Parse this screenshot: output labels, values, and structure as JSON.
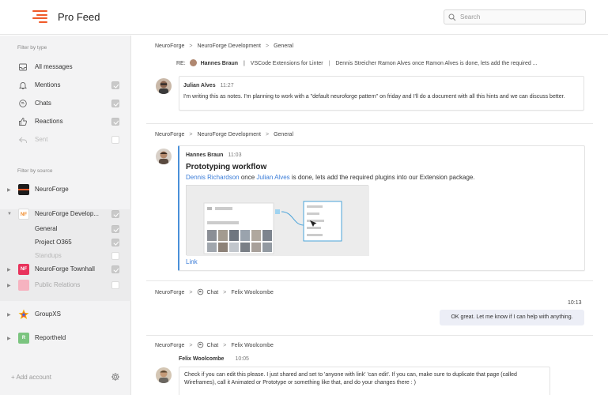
{
  "app": {
    "title": "Pro Feed"
  },
  "search": {
    "placeholder": "Search"
  },
  "sidebar": {
    "filter_by_type": "Filter by type",
    "types": [
      {
        "label": "All messages",
        "icon": "inbox-icon"
      },
      {
        "label": "Mentions",
        "icon": "bell-icon",
        "checked": true
      },
      {
        "label": "Chats",
        "icon": "chat-icon",
        "checked": true
      },
      {
        "label": "Reactions",
        "icon": "thumbs-up-icon",
        "checked": true
      },
      {
        "label": "Sent",
        "icon": "reply-icon",
        "checked": false
      }
    ],
    "filter_by_source": "Filter by source",
    "sources": {
      "neuroforge": "NeuroForge",
      "neuroforge_dev": "NeuroForge Develop...",
      "general": "General",
      "project_o365": "Project O365",
      "standups": "Standups",
      "townhall": "NeuroForge Townhall",
      "public_relations": "Public Relations",
      "groupxs": "GroupXS",
      "reportheld": "Reportheld"
    },
    "badges": {
      "dev": "NF",
      "townhall": "NF",
      "reportheld": "R"
    },
    "add_account": "+ Add account"
  },
  "feed": {
    "crumb_sep": ">",
    "item1": {
      "crumbs": [
        "NeuroForge",
        "NeuroForge Development",
        "General"
      ],
      "re_label": "RE:",
      "re_author": "Hannes Braun",
      "re_pipe": "|",
      "re_title": "VSCode Extensions for Linter",
      "re_pipe2": "|",
      "re_preview": "Dennis Streicher Ramon Alves once Ramon Alves is done, lets add the required ...",
      "author": "Julian Alves",
      "time": "11:27",
      "text": "I'm writing this as notes. I'm planning to work with a \"default neuroforge pattern\" on friday and I'll do a document with all this hints and we can discuss better."
    },
    "item2": {
      "crumbs": [
        "NeuroForge",
        "NeuroForge Development",
        "General"
      ],
      "author": "Hannes Braun",
      "time": "11:03",
      "title": "Prototyping workflow",
      "mention1": "Dennis Richardson",
      "mid": " once ",
      "mention2": "Julian Alves",
      "rest": " is done, lets add the required plugins into our Extension package.",
      "link": "Link"
    },
    "item3": {
      "crumbs": [
        "NeuroForge",
        "Chat",
        "Felix Woolcombe"
      ],
      "time": "10:13",
      "bubble": "OK great. Let me know if I can help with anything."
    },
    "item4": {
      "crumbs": [
        "NeuroForge",
        "Chat",
        "Felix Woolcombe"
      ],
      "author": "Felix Woolcombe",
      "time": "10:05",
      "text": "Check if you can edit this please. I just shared and set to 'anyone with link' 'can edit'. If you can, make sure to duplicate that page (called Wireframes), call it Animated or Prototype or something like that, and do your changes there : )"
    }
  },
  "colors": {
    "brand": "#f05a28",
    "mention": "#3b7dd8",
    "bubble": "#eceef6",
    "quote_bar": "#4a90d9"
  }
}
